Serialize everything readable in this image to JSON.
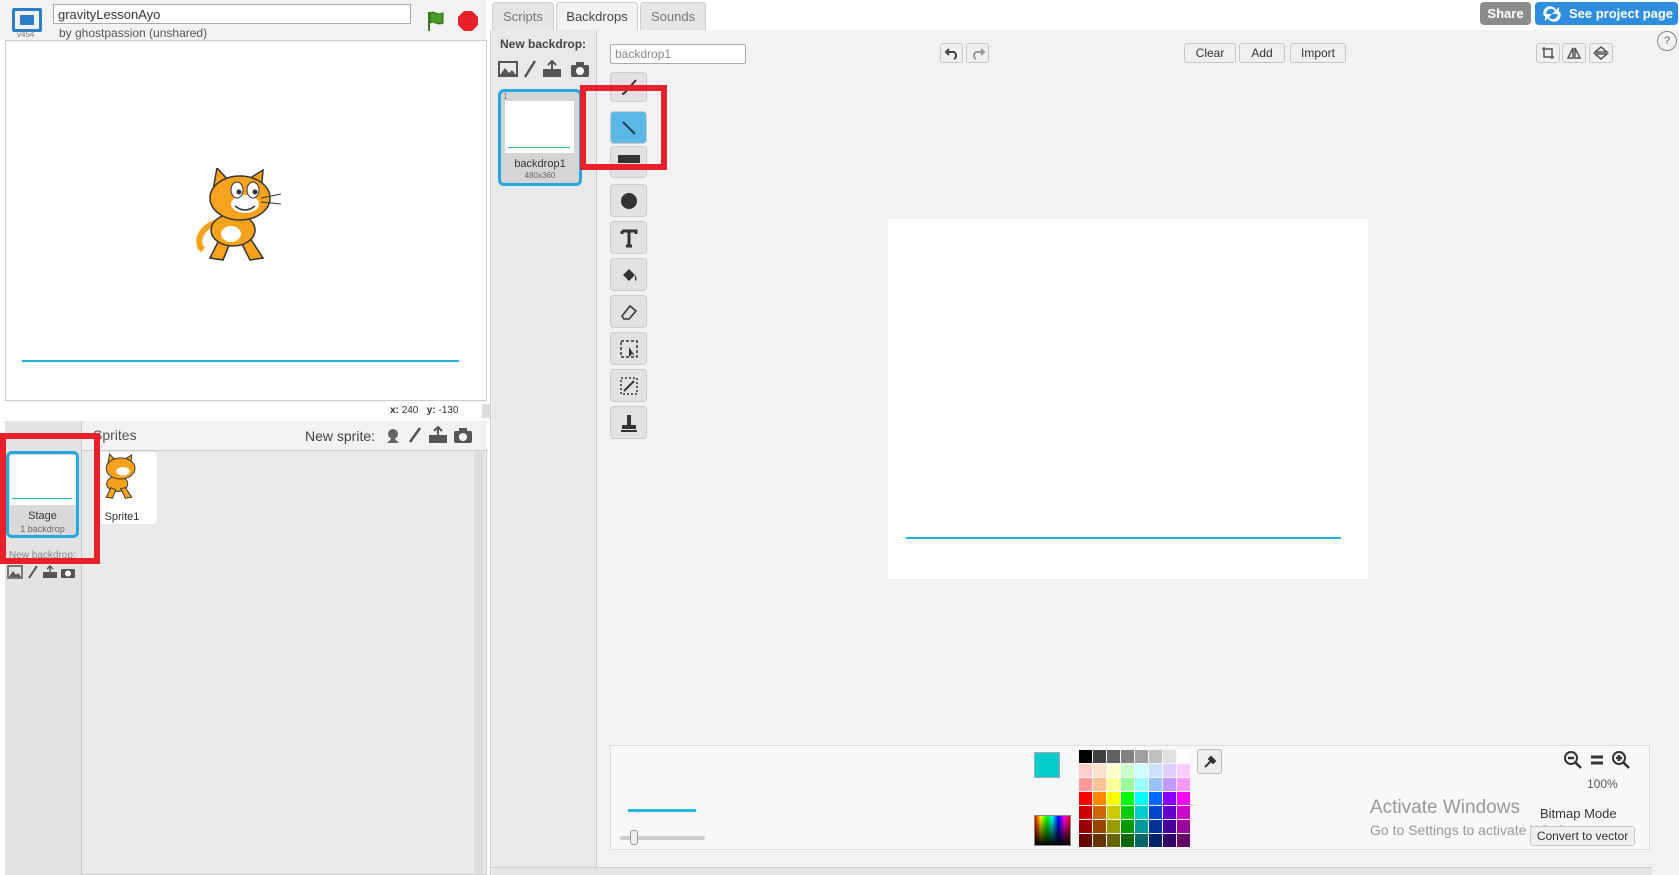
{
  "header": {
    "version": "v454",
    "project_title": "gravityLessonAyo",
    "author": "by ghostpassion (unshared)"
  },
  "stage": {
    "coords": {
      "x_label": "x:",
      "x": "240",
      "y_label": "y:",
      "y": "-130"
    }
  },
  "sprites_panel": {
    "title": "Sprites",
    "new_sprite_label": "New sprite:",
    "stage_item": {
      "name": "Stage",
      "sub": "1 backdrop"
    },
    "new_backdrop_label": "New backdrop:",
    "sprites": [
      {
        "name": "Sprite1"
      }
    ]
  },
  "tabs": [
    {
      "label": "Scripts"
    },
    {
      "label": "Backdrops",
      "active": true
    },
    {
      "label": "Sounds"
    }
  ],
  "top_buttons": {
    "share": "Share",
    "see_project": "See project page"
  },
  "backdrops": {
    "new_backdrop_label": "New backdrop:",
    "items": [
      {
        "index": "1",
        "name": "backdrop1",
        "size": "480x360"
      }
    ]
  },
  "editor": {
    "costume_name": "backdrop1",
    "clear_label": "Clear",
    "add_label": "Add",
    "import_label": "Import",
    "zoom_level": "100%",
    "mode_label": "Bitmap Mode",
    "convert_label": "Convert to vector",
    "help_label": "?",
    "tools": [
      "brush-icon",
      "line-icon",
      "rectangle-icon",
      "ellipse-icon",
      "text-icon",
      "fill-icon",
      "eraser-icon",
      "select-icon",
      "select-remove-bg-icon",
      "stamp-icon"
    ],
    "active_tool": "line-icon",
    "primary_color": "#00cccc",
    "secondary_color": "#ffffff"
  },
  "palette": [
    "#000000",
    "#404040",
    "#606060",
    "#808080",
    "#a0a0a0",
    "#c0c0c0",
    "#e0e0e0",
    "#ffffff",
    "#ffcccc",
    "#ffe0cc",
    "#ffffcc",
    "#ccffcc",
    "#ccffff",
    "#cce0ff",
    "#e0ccff",
    "#ffccff",
    "#ff9999",
    "#ffc299",
    "#ffff99",
    "#99ff99",
    "#99ffff",
    "#99c2ff",
    "#c299ff",
    "#ff99ff",
    "#ff0000",
    "#ff8800",
    "#ffff00",
    "#00ff00",
    "#00ffff",
    "#0066ff",
    "#8800ff",
    "#ff00ff",
    "#cc0000",
    "#cc6600",
    "#cccc00",
    "#00cc00",
    "#00cccc",
    "#0044cc",
    "#6600cc",
    "#cc00cc",
    "#990000",
    "#994400",
    "#999900",
    "#009900",
    "#009999",
    "#003399",
    "#440099",
    "#990099",
    "#660000",
    "#663300",
    "#666600",
    "#006600",
    "#006666",
    "#002266",
    "#330066",
    "#660066"
  ],
  "watermark": {
    "title": "Activate Windows",
    "subtitle": "Go to Settings to activate Windows."
  }
}
